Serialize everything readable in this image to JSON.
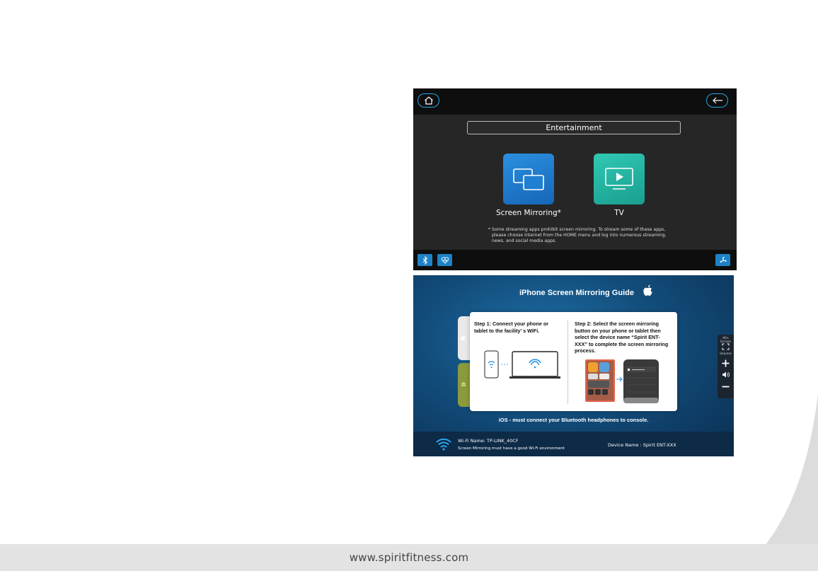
{
  "entertainment": {
    "title": "Entertainment",
    "apps": [
      {
        "label": "Screen Mirroring*",
        "icon": "screen-mirroring-icon",
        "color": "#1f7fd1"
      },
      {
        "label": "TV",
        "icon": "tv-icon",
        "color": "#23b5a4"
      }
    ],
    "note_lines": [
      "* Some streaming apps prohibit screen mirroring. To stream some of these apps,",
      "please choose Internet from the HOME menu and log into numerous streaming,",
      "news, and social media apps."
    ],
    "icons": [
      "home-icon",
      "back-arrow-icon",
      "bluetooth-icon",
      "heart-rate-icon",
      "fan-icon"
    ],
    "accent": "#29a3e8"
  },
  "guide": {
    "title": "iPhone Screen Mirroring Guide",
    "step1": [
      "Step 1: Connect your phone or",
      "tablet to the facility’ s WiFi."
    ],
    "step2": [
      "Step 2: Select the screen mirroring",
      "button on your phone or tablet then",
      "select the device name “Spirit ENT-",
      "XXX” to complete the screen mirroring",
      "process."
    ],
    "ios_note": "iOS - must connect your Bluetooth headphones to console.",
    "wifi_name": "Wi-Fi Name: TP-LINK_40CF",
    "wifi_note": "Screen Mirroring must have a good Wi-Fi environment",
    "device_name": "Device Name : Spirit ENT-XXX",
    "side_panel": {
      "top_label": "Win Screen",
      "volume_label": "Volume"
    }
  },
  "footer": {
    "url": "www.spiritfitness.com"
  }
}
